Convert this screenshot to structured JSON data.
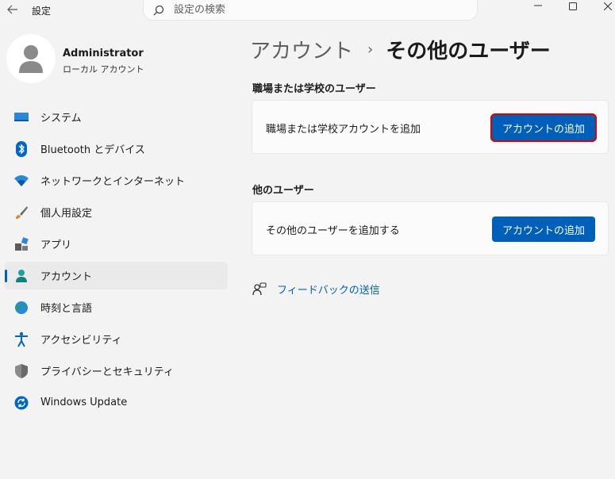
{
  "titlebar": {
    "app_title": "設定",
    "search_placeholder": "設定の検索"
  },
  "user": {
    "name": "Administrator",
    "account_type": "ローカル アカウント"
  },
  "sidebar": {
    "items": [
      {
        "label": "システム",
        "icon": "system-icon"
      },
      {
        "label": "Bluetooth とデバイス",
        "icon": "bluetooth-icon"
      },
      {
        "label": "ネットワークとインターネット",
        "icon": "wifi-icon"
      },
      {
        "label": "個人用設定",
        "icon": "brush-icon"
      },
      {
        "label": "アプリ",
        "icon": "apps-icon"
      },
      {
        "label": "アカウント",
        "icon": "account-icon",
        "active": true
      },
      {
        "label": "時刻と言語",
        "icon": "globe-icon"
      },
      {
        "label": "アクセシビリティ",
        "icon": "accessibility-icon"
      },
      {
        "label": "プライバシーとセキュリティ",
        "icon": "shield-icon"
      },
      {
        "label": "Windows Update",
        "icon": "update-icon"
      }
    ]
  },
  "breadcrumb": {
    "parent": "アカウント",
    "separator": "›",
    "current": "その他のユーザー"
  },
  "sections": {
    "work": {
      "title": "職場または学校のユーザー",
      "card_text": "職場または学校アカウントを追加",
      "button": "アカウントの追加"
    },
    "other": {
      "title": "他のユーザー",
      "card_text": "その他のユーザーを追加する",
      "button": "アカウントの追加"
    }
  },
  "feedback": {
    "label": "フィードバックの送信"
  },
  "colors": {
    "accent": "#005fb8",
    "highlight": "#e00000"
  }
}
